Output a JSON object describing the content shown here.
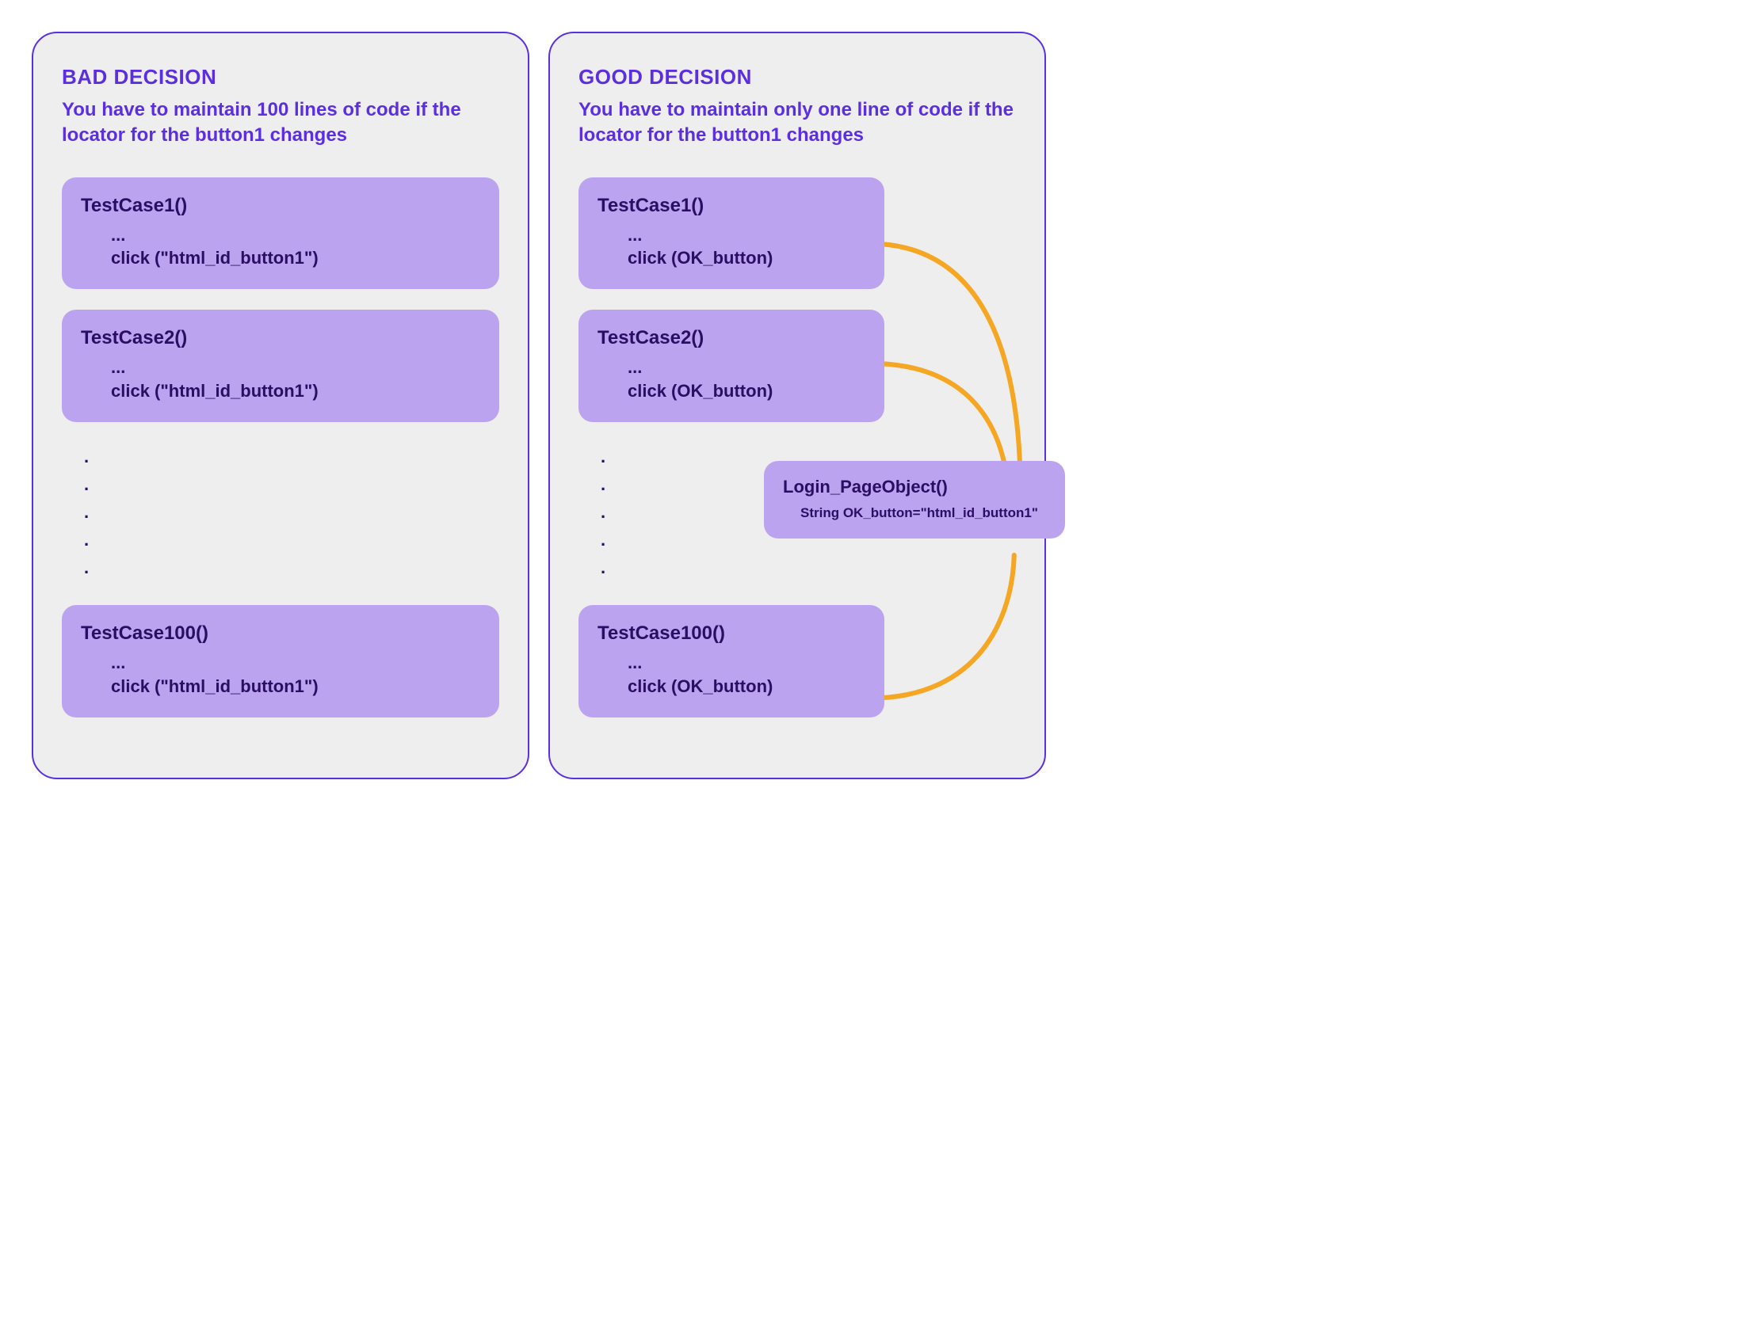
{
  "bad": {
    "title": "BAD DECISION",
    "subtitle": "You have to maintain 100 lines of code if the locator for the button1 changes",
    "cards": [
      {
        "name": "TestCase1()",
        "ellipsis": "...",
        "action": "click (\"html_id_button1\")"
      },
      {
        "name": "TestCase2()",
        "ellipsis": "...",
        "action": "click (\"html_id_button1\")"
      },
      {
        "name": "TestCase100()",
        "ellipsis": "...",
        "action": "click (\"html_id_button1\")"
      }
    ],
    "dots": [
      ".",
      ".",
      ".",
      ".",
      "."
    ]
  },
  "good": {
    "title": "GOOD DECISION",
    "subtitle": "You have to maintain only one line of code if the locator for the button1 changes",
    "cards": [
      {
        "name": "TestCase1()",
        "ellipsis": "...",
        "action": "click (OK_button)"
      },
      {
        "name": "TestCase2()",
        "ellipsis": "...",
        "action": "click (OK_button)"
      },
      {
        "name": "TestCase100()",
        "ellipsis": "...",
        "action": "click (OK_button)"
      }
    ],
    "dots": [
      ".",
      ".",
      ".",
      ".",
      "."
    ],
    "pageObject": {
      "name": "Login_PageObject()",
      "code": "String OK_button=\"html_id_button1\""
    }
  },
  "colors": {
    "accent_purple": "#5B2FE0",
    "card_purple": "#BBA3F0",
    "text_dark": "#2A0E63",
    "connector_orange": "#F5A623",
    "panel_bg": "#EEEEEE"
  }
}
